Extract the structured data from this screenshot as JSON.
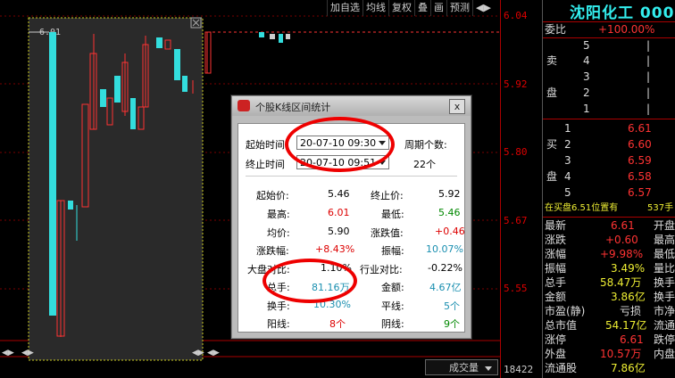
{
  "toolbar": {
    "items": [
      "加自选",
      "均线",
      "复权",
      "叠",
      "画",
      "预测",
      "◀▶"
    ]
  },
  "price_axis": {
    "labels": [
      "6.04",
      "5.92",
      "5.80",
      "5.67",
      "5.55"
    ],
    "bottom_label": "18422"
  },
  "chart": {
    "high_marker": "6.01",
    "volume_label": "成交量"
  },
  "panel": {
    "stock_name": "沈阳化工 000",
    "wei_bi_label": "委比",
    "wei_bi_value": "+100.00%",
    "sell_label": [
      "卖",
      "盘"
    ],
    "sell_rows": [
      {
        "n": "5",
        "p": "",
        "v": ""
      },
      {
        "n": "4",
        "p": "",
        "v": ""
      },
      {
        "n": "3",
        "p": "",
        "v": ""
      },
      {
        "n": "2",
        "p": "",
        "v": ""
      },
      {
        "n": "1",
        "p": "",
        "v": ""
      }
    ],
    "buy_label": [
      "买",
      "盘"
    ],
    "buy_rows": [
      {
        "n": "1",
        "p": "6.61"
      },
      {
        "n": "2",
        "p": "6.60"
      },
      {
        "n": "3",
        "p": "6.59"
      },
      {
        "n": "4",
        "p": "6.58"
      },
      {
        "n": "5",
        "p": "6.57"
      }
    ],
    "notice": "在买盘6.51位置有",
    "notice_value": "537手",
    "stats": [
      {
        "l": "最新",
        "v": "6.61",
        "r": "开盘"
      },
      {
        "l": "涨跌",
        "v": "+0.60",
        "r": "最高"
      },
      {
        "l": "涨幅",
        "v": "+9.98%",
        "r": "最低"
      },
      {
        "l": "振幅",
        "v": "3.49%",
        "r": "量比"
      },
      {
        "l": "总手",
        "v": "58.47万",
        "r": "换手"
      },
      {
        "l": "金额",
        "v": "3.86亿",
        "r": "换手"
      },
      {
        "l": "市盈(静)",
        "v": "亏损",
        "r": "市净"
      },
      {
        "l": "总市值",
        "v": "54.17亿",
        "r": "流通"
      },
      {
        "l": "涨停",
        "v": "6.61",
        "r": "跌停"
      },
      {
        "l": "外盘",
        "v": "10.57万",
        "r": "内盘"
      },
      {
        "l": "流通股",
        "v": "7.86亿",
        "r": ""
      }
    ]
  },
  "dialog": {
    "title": "个股K线区间统计",
    "close": "x",
    "start_label": "起始时间",
    "start_value": "20-07-10 09:30",
    "end_label": "终止时间",
    "end_value": "20-07-10 09:51",
    "period_label": "周期个数:",
    "period_value": "22个",
    "rows": [
      {
        "l1": "起始价:",
        "v1": "5.46",
        "l2": "终止价:",
        "v2": "5.92"
      },
      {
        "l1": "最高:",
        "v1": "6.01",
        "l2": "最低:",
        "v2": "5.46"
      },
      {
        "l1": "均价:",
        "v1": "5.90",
        "l2": "涨跌值:",
        "v2": "+0.46"
      },
      {
        "l1": "涨跌幅:",
        "v1": "+8.43%",
        "l2": "振幅:",
        "v2": "10.07%"
      },
      {
        "l1": "大盘对比:",
        "v1": "1.10%",
        "l2": "行业对比:",
        "v2": "-0.22%"
      },
      {
        "l1": "总手:",
        "v1": "81.16万",
        "l2": "金额:",
        "v2": "4.67亿"
      },
      {
        "l1": "换手:",
        "v1": "10.30%",
        "l2": "平线:",
        "v2": "5个"
      },
      {
        "l1": "阳线:",
        "v1": "8个",
        "l2": "阴线:",
        "v2": "9个"
      }
    ]
  }
}
